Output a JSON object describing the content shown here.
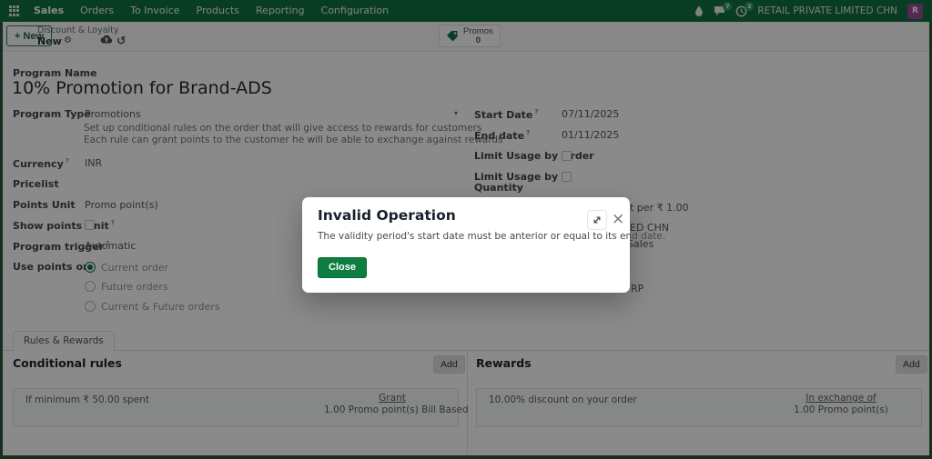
{
  "icons": {
    "plus": "+",
    "gear": "⚙",
    "undo": "↺",
    "caret": "▾",
    "close_x": "×",
    "help_marker": "?"
  },
  "nav": {
    "app_menus": [
      "Sales",
      "Orders",
      "To Invoice",
      "Products",
      "Reporting",
      "Configuration"
    ],
    "message_count": "7",
    "activity_count": "2",
    "company": "RETAIL PRIVATE LIMITED CHN",
    "avatar_initial": "R"
  },
  "control_panel": {
    "new_label": "New",
    "breadcrumb_parent": "Discount & Loyalty",
    "breadcrumb_current": "New",
    "promos_label": "Promos",
    "promos_count": "0"
  },
  "form": {
    "program_name_label": "Program Name",
    "program_name": "10% Promotion for Brand-ADS",
    "program_type_label": "Program Type",
    "program_type": "Promotions",
    "program_type_help1": "Set up conditional rules on the order that will give access to rewards for customers",
    "program_type_help2": "Each rule can grant points to the customer he will be able to exchange against rewards",
    "currency_label": "Currency",
    "currency": "INR",
    "pricelist_label": "Pricelist",
    "points_unit_label": "Points Unit",
    "points_unit": "Promo point(s)",
    "show_points_unit_label": "Show points Unit",
    "program_trigger_label": "Program trigger",
    "program_trigger": "Automatic",
    "use_points_on_label": "Use points on",
    "use_points_options": [
      "Current order",
      "Future orders",
      "Current & Future orders"
    ],
    "start_date_label": "Start Date",
    "start_date": "07/11/2025",
    "end_date_label": "End date",
    "end_date": "01/11/2025",
    "limit_order_label": "Limit Usage by Order",
    "limit_qty_label_line1": "Limit Usage by",
    "limit_qty_label_line2": "Quantity",
    "occluded": {
      "row1": "t per ₹ 1.00",
      "row2": "ED CHN",
      "row3": "Sales",
      "row4": "RP"
    }
  },
  "tabs": {
    "rules_rewards": "Rules & Rewards"
  },
  "rules_section": {
    "title": "Conditional rules",
    "add_label": "Add",
    "card": {
      "text": "If minimum ₹ 50.00 spent",
      "link": "Grant",
      "detail": "1.00 Promo point(s) Bill Based"
    }
  },
  "rewards_section": {
    "title": "Rewards",
    "add_label": "Add",
    "card": {
      "text": "10.00% discount on your order",
      "link": "In exchange of",
      "detail": "1.00 Promo point(s)"
    }
  },
  "modal": {
    "title": "Invalid Operation",
    "message": "The validity period's start date must be anterior or equal to its end date.",
    "close_label": "Close"
  },
  "colors": {
    "navbar": "#127142",
    "accent": "#157347",
    "close_button": "#0e7d40",
    "badge": "#2f9e57",
    "avatar_bg": "#9b4d96",
    "frame": "#2b5939"
  }
}
